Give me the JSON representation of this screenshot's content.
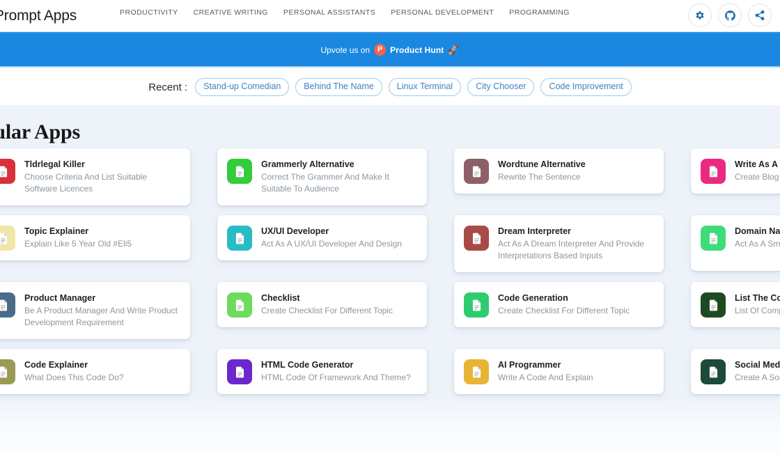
{
  "header": {
    "brand": "Prompt Apps",
    "nav": [
      {
        "label": "PRODUCTIVITY"
      },
      {
        "label": "CREATIVE WRITING"
      },
      {
        "label": "PERSONAL ASSISTANTS"
      },
      {
        "label": "PERSONAL DEVELOPMENT"
      },
      {
        "label": "PROGRAMMING"
      }
    ],
    "actions": [
      {
        "name": "settings-icon",
        "title": "Settings"
      },
      {
        "name": "github-icon",
        "title": "GitHub"
      },
      {
        "name": "share-icon",
        "title": "Share"
      }
    ],
    "accent_color": "#2a6fb0"
  },
  "banner": {
    "prefix": "Upvote us on",
    "badge": "P",
    "label": "Product Hunt",
    "rocket": "🚀",
    "background_color": "#1a88e0",
    "badge_color": "#f8614a"
  },
  "recent": {
    "label": "Recent :",
    "chips": [
      {
        "label": "Stand-up Comedian"
      },
      {
        "label": "Behind The Name"
      },
      {
        "label": "Linux Terminal"
      },
      {
        "label": "City Chooser"
      },
      {
        "label": "Code Improvement"
      }
    ],
    "chip_color": "#3f82c0"
  },
  "main": {
    "section_title": "Popular Apps",
    "cards": [
      {
        "title": "Tldrlegal Killer",
        "desc": "Choose Criteria And List Suitable Software Licences",
        "color": "#d8313b",
        "tall": true
      },
      {
        "title": "Grammerly Alternative",
        "desc": "Correct The Grammer And Make It Suitable To Audience",
        "color": "#35cc3c",
        "tall": true
      },
      {
        "title": "Wordtune Alternative",
        "desc": "Rewrite The Sentence",
        "color": "#8e5f66",
        "tall": false
      },
      {
        "title": "Write As A Blogger",
        "desc": "Create Blog Meta",
        "color": "#ea2a7f",
        "tall": false
      },
      {
        "title": "Topic Explainer",
        "desc": "Explain Like 5 Year Old #Eli5",
        "color": "#f0e6a8",
        "tall": false
      },
      {
        "title": "UX/UI Developer",
        "desc": "Act As A UX/UI Developer And Design",
        "color": "#28bcc4",
        "tall": false
      },
      {
        "title": "Dream Interpreter",
        "desc": "Act As A Dream Interpreter And Provide Interpretations Based Inputs",
        "color": "#a84a47",
        "tall": true
      },
      {
        "title": "Domain Name Generator",
        "desc": "Act As A Smart Domain Suggest",
        "color": "#3ddc79",
        "tall": true
      },
      {
        "title": "Product Manager",
        "desc": "Be A Product Manager And Write Product Development Requirement",
        "color": "#4b6b8a",
        "tall": true
      },
      {
        "title": "Checklist",
        "desc": "Create Checklist For Different Topic",
        "color": "#6ddb5c",
        "tall": false
      },
      {
        "title": "Code Generation",
        "desc": "Create Checklist For Different Topic",
        "color": "#2ecc71",
        "tall": false
      },
      {
        "title": "List The Competitors",
        "desc": "List Of Competitors",
        "color": "#1d4a22",
        "tall": false
      },
      {
        "title": "Code Explainer",
        "desc": "What Does This Code Do?",
        "color": "#9a9a55",
        "tall": false
      },
      {
        "title": "HTML Code Generator",
        "desc": "HTML Code Of Framework And Theme?",
        "color": "#6c28cc",
        "tall": false
      },
      {
        "title": "AI Programmer",
        "desc": "Write A Code And Explain",
        "color": "#e8b435",
        "tall": false
      },
      {
        "title": "Social Media Post",
        "desc": "Create A Social Media Post",
        "color": "#1d4a3a",
        "tall": false
      }
    ]
  }
}
